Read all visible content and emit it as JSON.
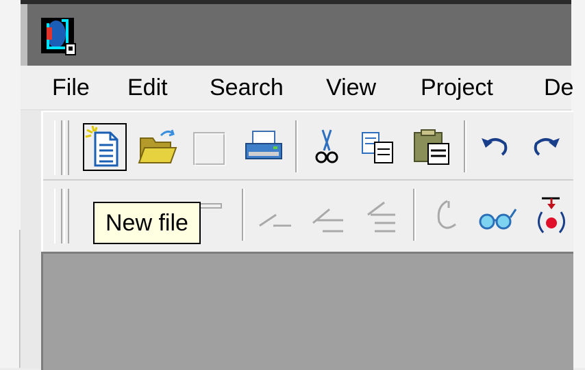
{
  "window": {
    "app_icon": "app-logo-icon"
  },
  "menubar": {
    "items": [
      "File",
      "Edit",
      "Search",
      "View",
      "Project",
      "De"
    ]
  },
  "toolbar1": {
    "buttons": [
      {
        "name": "new-file-button",
        "icon": "new-file-icon"
      },
      {
        "name": "open-file-button",
        "icon": "open-folder-icon"
      },
      {
        "name": "save-button",
        "icon": "blank-disabled-icon"
      },
      {
        "name": "print-button",
        "icon": "printer-icon"
      },
      {
        "name": "cut-button",
        "icon": "scissors-icon"
      },
      {
        "name": "copy-button",
        "icon": "copy-icon"
      },
      {
        "name": "paste-button",
        "icon": "clipboard-icon"
      },
      {
        "name": "undo-button",
        "icon": "undo-icon"
      },
      {
        "name": "redo-button",
        "icon": "redo-icon"
      }
    ]
  },
  "toolbar2": {
    "buttons": [
      {
        "name": "debug-button-1",
        "icon": "disabled-icon"
      },
      {
        "name": "debug-button-2",
        "icon": "disabled-icon"
      },
      {
        "name": "debug-button-3",
        "icon": "disabled-icon"
      },
      {
        "name": "indent-button-1",
        "icon": "line-disabled-icon"
      },
      {
        "name": "indent-button-2",
        "icon": "indent-disabled-icon"
      },
      {
        "name": "indent-button-3",
        "icon": "outdent-disabled-icon"
      },
      {
        "name": "breakpoint-disabled-button",
        "icon": "breakpoint-disabled-icon"
      },
      {
        "name": "watch-button",
        "icon": "glasses-icon"
      },
      {
        "name": "run-to-cursor-button",
        "icon": "breakpoint-icon"
      }
    ]
  },
  "tooltip": {
    "text": "New file"
  },
  "colors": {
    "titlebar": "#6b6b6b",
    "tooltip_bg": "#ffffe1",
    "workspace": "#a0a0a0"
  }
}
